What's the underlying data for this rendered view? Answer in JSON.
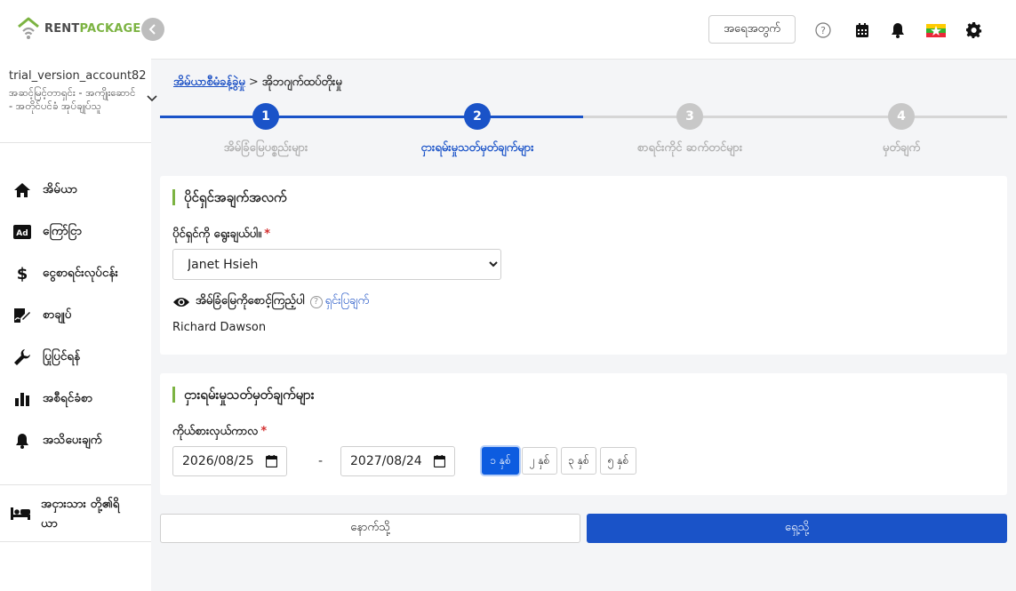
{
  "brand": {
    "part1": "RENT",
    "part2": "PACKAGE"
  },
  "account": {
    "name": "trial_version_account82",
    "role": "အဆင့်မြင့်တာရှင်း - အကျိုးဆောင် - အတိုင်ပင်ခံ အုပ်ချုပ်သူ"
  },
  "nav": {
    "items": [
      {
        "label": "အိမ်ယာ",
        "icon": "home-icon"
      },
      {
        "label": "ကြော်ငြာ",
        "icon": "ad-icon"
      },
      {
        "label": "ငွေစာရင်းလုပ်ငန်း",
        "icon": "dollar-icon"
      },
      {
        "label": "စာချုပ်",
        "icon": "contract-icon"
      },
      {
        "label": "ပြုပြင်ရန်",
        "icon": "wrench-icon"
      },
      {
        "label": "အစီရင်ခံစာ",
        "icon": "chart-icon"
      },
      {
        "label": "အသိပေးချက်",
        "icon": "bell-icon"
      }
    ],
    "bottom_label": "အငှားသား တို့၏ရိယာ"
  },
  "header": {
    "logout_label": "အရေအတွက်"
  },
  "breadcrumb": {
    "link": "အိမ်ယာစီမံခန့်ခွဲမှု",
    "separator": ">",
    "current": "အိုဘဂျက်ထပ်တိုးမှု"
  },
  "stepper": {
    "steps": [
      {
        "number": "1",
        "label": "အိမ်ခြံမြေပစ္စည်းများ",
        "state": "done"
      },
      {
        "number": "2",
        "label": "ငှားရမ်းမှုသတ်မှတ်ချက်များ",
        "state": "active"
      },
      {
        "number": "3",
        "label": "စာရင်းကိုင် ဆက်တင်များ",
        "state": "pending"
      },
      {
        "number": "4",
        "label": "မှတ်ချက်",
        "state": "pending"
      }
    ]
  },
  "owner_card": {
    "title": "ပိုင်ရှင်အချက်အလက်",
    "select_label": "ပိုင်ရှင်ကို ရွေးချယ်ပါ။",
    "selected_owner": "Janet Hsieh",
    "view_label": "အိမ်ခြံမြေကိုစောင့်ကြည့်ပါ",
    "explain_label": "ရှင်းပြချက်",
    "watcher_name": "Richard Dawson"
  },
  "rental_card": {
    "title": "ငှားရမ်းမှုသတ်မှတ်ချက်များ",
    "period_label": "ကိုယ်စားလှယ်ကာလ",
    "start_date": "2026/08/25",
    "end_date": "2027/08/24",
    "dash": "-",
    "period_options": [
      "၁ နှစ်",
      "၂ နှစ်",
      "၃ နှစ်",
      "၅ နှစ်"
    ],
    "selected_period_index": 0
  },
  "actions": {
    "back_label": "နောက်သို့",
    "next_label": "ရှေ့သို့"
  },
  "colors": {
    "primary": "#1a53c8",
    "accent_green": "#7cb342",
    "pending_grey": "#c8c8c8"
  }
}
